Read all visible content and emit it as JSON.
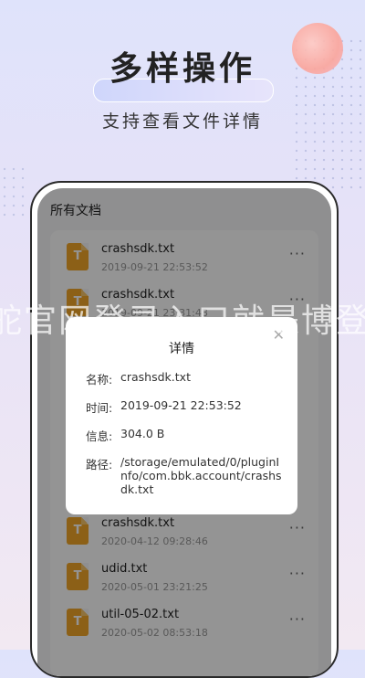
{
  "promo": {
    "headline": "多样操作",
    "subline": "支持查看文件详情"
  },
  "screen": {
    "title": "所有文档",
    "file_icon_letter": "T",
    "more_glyph": "···",
    "files": [
      {
        "name": "crashsdk.txt",
        "date": "2019-09-21 22:53:52"
      },
      {
        "name": "crashsdk.txt",
        "date": "2019-09-21 23:31:48"
      },
      {
        "name": "crashsdk.txt",
        "date": "2020-04-12 09:28:46"
      },
      {
        "name": "udid.txt",
        "date": "2020-05-01 23:21:25"
      },
      {
        "name": "util-05-02.txt",
        "date": "2020-05-02 08:53:18"
      }
    ]
  },
  "dialog": {
    "title": "详情",
    "close_icon": "close-icon",
    "fields": [
      {
        "label": "名称:",
        "value": "crashsdk.txt"
      },
      {
        "label": "时间:",
        "value": "2019-09-21 22:53:52"
      },
      {
        "label": "信息:",
        "value": "304.0 B"
      },
      {
        "label": "路径:",
        "value": "/storage/emulated/0/pluginInfo/com.bbk.account/crashsdk.txt"
      }
    ]
  },
  "watermark": "舵官网登录入口就是博登",
  "colors": {
    "accent": "#f2a628",
    "overlay": "rgba(0,0,0,0.42)"
  }
}
